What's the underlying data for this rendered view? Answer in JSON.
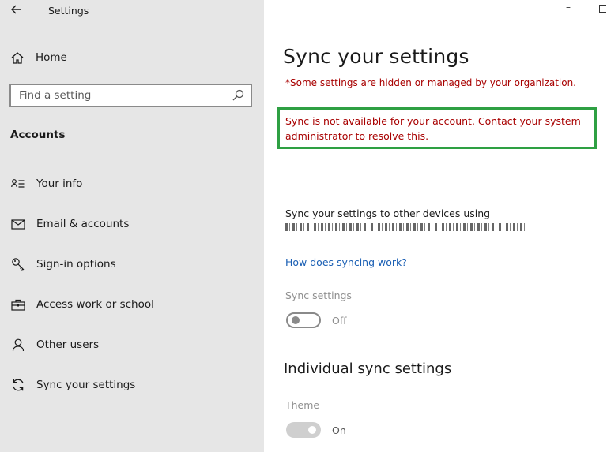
{
  "window": {
    "title": "Settings",
    "minimize_glyph": "–"
  },
  "sidebar": {
    "home_label": "Home",
    "search_placeholder": "Find a setting",
    "section_heading": "Accounts",
    "items": [
      {
        "label": "Your info",
        "icon": "person-card-icon"
      },
      {
        "label": "Email & accounts",
        "icon": "mail-icon"
      },
      {
        "label": "Sign-in options",
        "icon": "key-icon"
      },
      {
        "label": "Access work or school",
        "icon": "briefcase-icon"
      },
      {
        "label": "Other users",
        "icon": "person-icon"
      },
      {
        "label": "Sync your settings",
        "icon": "sync-icon"
      }
    ]
  },
  "main": {
    "title": "Sync your settings",
    "hidden_notice": "*Some settings are hidden or managed by your organization.",
    "alert": "Sync is not available for your account. Contact your system administrator to resolve this.",
    "sync_description": "Sync your settings to other devices using",
    "how_link": "How does syncing work?",
    "sync_settings_label": "Sync settings",
    "sync_settings_state": "Off",
    "individual_heading": "Individual sync settings",
    "theme_label": "Theme",
    "theme_state": "On"
  },
  "colors": {
    "sidebar_bg": "#e6e6e6",
    "alert_red": "#a80000",
    "alert_border": "#2ea043",
    "link_blue": "#1a5fb4"
  }
}
